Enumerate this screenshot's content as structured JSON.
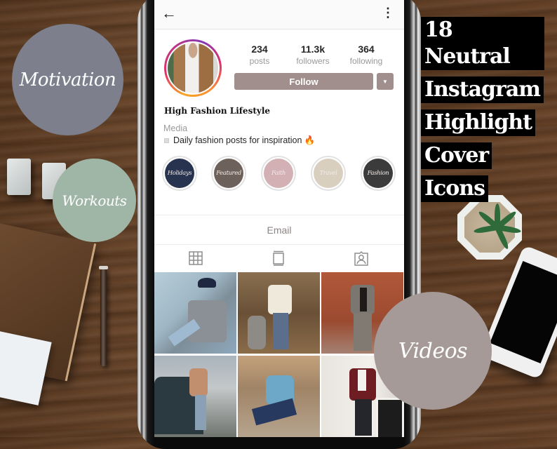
{
  "headline": {
    "lines": [
      "18 Neutral",
      "Instagram",
      "Highlight",
      "Cover",
      "Icons"
    ]
  },
  "promo_icons": [
    {
      "label": "Motivation",
      "color": "#7d808c"
    },
    {
      "label": "Workouts",
      "color": "#9fb5a6"
    },
    {
      "label": "Videos",
      "color": "#a69a98"
    }
  ],
  "profile": {
    "nav": {
      "back_icon": "arrow-left-icon",
      "menu_icon": "more-vertical-icon"
    },
    "stats": [
      {
        "value": "234",
        "label": "posts"
      },
      {
        "value": "11.3k",
        "label": "followers"
      },
      {
        "value": "364",
        "label": "following"
      }
    ],
    "follow_label": "Follow",
    "follow_dropdown_glyph": "▼",
    "accent_color": "#a08f8d",
    "name": "High Fashion Lifestyle",
    "category": "Media",
    "bio": "Daily fashion posts for inspiration 🔥",
    "highlights": [
      {
        "label": "Holidays",
        "color": "#283350"
      },
      {
        "label": "Featured",
        "color": "#6d615c"
      },
      {
        "label": "Faith",
        "color": "#d2b0b4"
      },
      {
        "label": "Travel",
        "color": "#d8cfbf"
      },
      {
        "label": "Fashion",
        "color": "#3b3b3b"
      }
    ],
    "email_label": "Email",
    "tabs": [
      {
        "name": "grid",
        "icon": "grid-icon"
      },
      {
        "name": "feed",
        "icon": "feed-icon"
      },
      {
        "name": "tagged",
        "icon": "tagged-icon"
      }
    ],
    "posts": [
      {
        "desc": "man in hat and ripped jeans sitting by window"
      },
      {
        "desc": "man in cream sweater walking husky in autumn park"
      },
      {
        "desc": "man in grey suit by red sandstone building"
      },
      {
        "desc": "man in tan sweater leaning on SUV overlooking city"
      },
      {
        "desc": "man in denim shirt sitting in desert"
      },
      {
        "desc": "man in burgundy tuxedo jacket by fireplace"
      }
    ]
  }
}
